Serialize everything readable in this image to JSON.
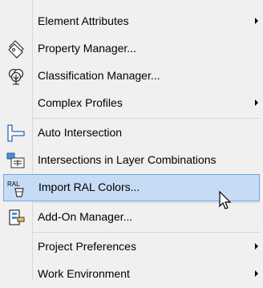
{
  "menu": {
    "items": [
      {
        "label": "Element Attributes",
        "icon": "",
        "submenu": true
      },
      {
        "label": "Property Manager...",
        "icon": "property-tag-icon",
        "submenu": false
      },
      {
        "label": "Classification Manager...",
        "icon": "classification-tree-icon",
        "submenu": false
      },
      {
        "label": "Complex Profiles",
        "icon": "",
        "submenu": true
      },
      {
        "label": "Auto Intersection",
        "icon": "auto-intersection-icon",
        "submenu": false
      },
      {
        "label": "Intersections in Layer Combinations",
        "icon": "layer-intersection-icon",
        "submenu": false
      },
      {
        "label": "Import RAL Colors...",
        "icon": "ral-bucket-icon",
        "icon_text": "RAL",
        "submenu": false,
        "highlighted": true
      },
      {
        "label": "Add-On Manager...",
        "icon": "addon-manager-icon",
        "submenu": false
      },
      {
        "label": "Project Preferences",
        "icon": "",
        "submenu": true
      },
      {
        "label": "Work Environment",
        "icon": "",
        "submenu": true
      }
    ]
  },
  "colors": {
    "highlight_bg": "#c6dcf5",
    "highlight_border": "#6fa7e2"
  }
}
